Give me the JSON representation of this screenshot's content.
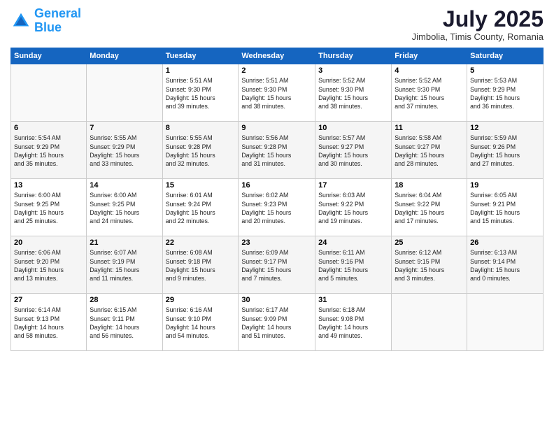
{
  "header": {
    "logo_line1": "General",
    "logo_line2": "Blue",
    "month": "July 2025",
    "location": "Jimbolia, Timis County, Romania"
  },
  "days_of_week": [
    "Sunday",
    "Monday",
    "Tuesday",
    "Wednesday",
    "Thursday",
    "Friday",
    "Saturday"
  ],
  "weeks": [
    [
      {
        "day": "",
        "info": ""
      },
      {
        "day": "",
        "info": ""
      },
      {
        "day": "1",
        "info": "Sunrise: 5:51 AM\nSunset: 9:30 PM\nDaylight: 15 hours\nand 39 minutes."
      },
      {
        "day": "2",
        "info": "Sunrise: 5:51 AM\nSunset: 9:30 PM\nDaylight: 15 hours\nand 38 minutes."
      },
      {
        "day": "3",
        "info": "Sunrise: 5:52 AM\nSunset: 9:30 PM\nDaylight: 15 hours\nand 38 minutes."
      },
      {
        "day": "4",
        "info": "Sunrise: 5:52 AM\nSunset: 9:30 PM\nDaylight: 15 hours\nand 37 minutes."
      },
      {
        "day": "5",
        "info": "Sunrise: 5:53 AM\nSunset: 9:29 PM\nDaylight: 15 hours\nand 36 minutes."
      }
    ],
    [
      {
        "day": "6",
        "info": "Sunrise: 5:54 AM\nSunset: 9:29 PM\nDaylight: 15 hours\nand 35 minutes."
      },
      {
        "day": "7",
        "info": "Sunrise: 5:55 AM\nSunset: 9:29 PM\nDaylight: 15 hours\nand 33 minutes."
      },
      {
        "day": "8",
        "info": "Sunrise: 5:55 AM\nSunset: 9:28 PM\nDaylight: 15 hours\nand 32 minutes."
      },
      {
        "day": "9",
        "info": "Sunrise: 5:56 AM\nSunset: 9:28 PM\nDaylight: 15 hours\nand 31 minutes."
      },
      {
        "day": "10",
        "info": "Sunrise: 5:57 AM\nSunset: 9:27 PM\nDaylight: 15 hours\nand 30 minutes."
      },
      {
        "day": "11",
        "info": "Sunrise: 5:58 AM\nSunset: 9:27 PM\nDaylight: 15 hours\nand 28 minutes."
      },
      {
        "day": "12",
        "info": "Sunrise: 5:59 AM\nSunset: 9:26 PM\nDaylight: 15 hours\nand 27 minutes."
      }
    ],
    [
      {
        "day": "13",
        "info": "Sunrise: 6:00 AM\nSunset: 9:25 PM\nDaylight: 15 hours\nand 25 minutes."
      },
      {
        "day": "14",
        "info": "Sunrise: 6:00 AM\nSunset: 9:25 PM\nDaylight: 15 hours\nand 24 minutes."
      },
      {
        "day": "15",
        "info": "Sunrise: 6:01 AM\nSunset: 9:24 PM\nDaylight: 15 hours\nand 22 minutes."
      },
      {
        "day": "16",
        "info": "Sunrise: 6:02 AM\nSunset: 9:23 PM\nDaylight: 15 hours\nand 20 minutes."
      },
      {
        "day": "17",
        "info": "Sunrise: 6:03 AM\nSunset: 9:22 PM\nDaylight: 15 hours\nand 19 minutes."
      },
      {
        "day": "18",
        "info": "Sunrise: 6:04 AM\nSunset: 9:22 PM\nDaylight: 15 hours\nand 17 minutes."
      },
      {
        "day": "19",
        "info": "Sunrise: 6:05 AM\nSunset: 9:21 PM\nDaylight: 15 hours\nand 15 minutes."
      }
    ],
    [
      {
        "day": "20",
        "info": "Sunrise: 6:06 AM\nSunset: 9:20 PM\nDaylight: 15 hours\nand 13 minutes."
      },
      {
        "day": "21",
        "info": "Sunrise: 6:07 AM\nSunset: 9:19 PM\nDaylight: 15 hours\nand 11 minutes."
      },
      {
        "day": "22",
        "info": "Sunrise: 6:08 AM\nSunset: 9:18 PM\nDaylight: 15 hours\nand 9 minutes."
      },
      {
        "day": "23",
        "info": "Sunrise: 6:09 AM\nSunset: 9:17 PM\nDaylight: 15 hours\nand 7 minutes."
      },
      {
        "day": "24",
        "info": "Sunrise: 6:11 AM\nSunset: 9:16 PM\nDaylight: 15 hours\nand 5 minutes."
      },
      {
        "day": "25",
        "info": "Sunrise: 6:12 AM\nSunset: 9:15 PM\nDaylight: 15 hours\nand 3 minutes."
      },
      {
        "day": "26",
        "info": "Sunrise: 6:13 AM\nSunset: 9:14 PM\nDaylight: 15 hours\nand 0 minutes."
      }
    ],
    [
      {
        "day": "27",
        "info": "Sunrise: 6:14 AM\nSunset: 9:13 PM\nDaylight: 14 hours\nand 58 minutes."
      },
      {
        "day": "28",
        "info": "Sunrise: 6:15 AM\nSunset: 9:11 PM\nDaylight: 14 hours\nand 56 minutes."
      },
      {
        "day": "29",
        "info": "Sunrise: 6:16 AM\nSunset: 9:10 PM\nDaylight: 14 hours\nand 54 minutes."
      },
      {
        "day": "30",
        "info": "Sunrise: 6:17 AM\nSunset: 9:09 PM\nDaylight: 14 hours\nand 51 minutes."
      },
      {
        "day": "31",
        "info": "Sunrise: 6:18 AM\nSunset: 9:08 PM\nDaylight: 14 hours\nand 49 minutes."
      },
      {
        "day": "",
        "info": ""
      },
      {
        "day": "",
        "info": ""
      }
    ]
  ]
}
